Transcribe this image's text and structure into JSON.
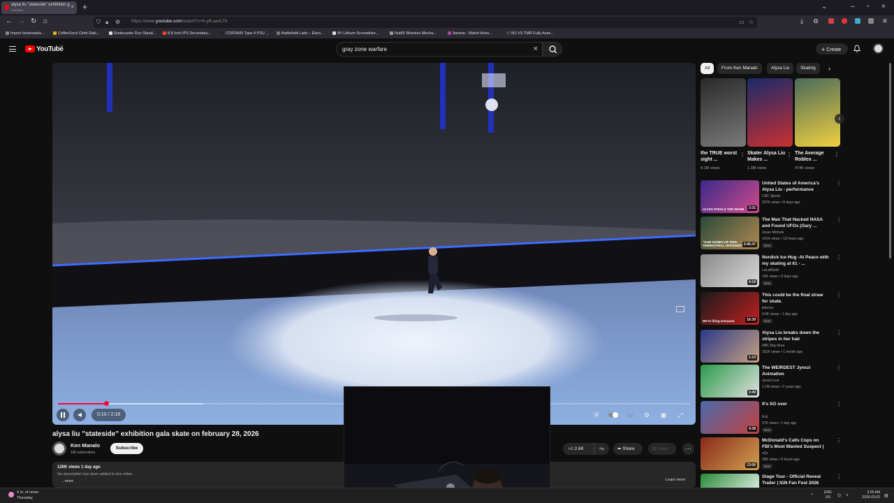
{
  "browser": {
    "tab_title": "alysa liu \"stateside\" exhibition g",
    "tab_sub": "PLAYING",
    "url_prefix": "https://www.",
    "url_domain": "youtube.com",
    "url_rest": "/watch?v=h-yB-awtLTk",
    "bookmarks": [
      {
        "label": "Import bookmarks...",
        "color": "#888888"
      },
      {
        "label": "CoffeeSock Cloth Disk...",
        "color": "#e8b400"
      },
      {
        "label": "Rodecaster Duo Stand...",
        "color": "#dddddd"
      },
      {
        "label": "8.8 Inch IPS Secondary...",
        "color": "#ff4422"
      },
      {
        "label": "CORSAIR Type 4 PSU ...",
        "color": "#222222"
      },
      {
        "label": "Battlefield Labs – Elect...",
        "color": "#777777"
      },
      {
        "label": "4V Lithium Screwdrive...",
        "color": "#dddddd"
      },
      {
        "label": "Nut65 Wireless Mecha...",
        "color": "#999999"
      },
      {
        "label": "9anime - Watch Anim...",
        "color": "#aa44aa"
      },
      {
        "label": "M1 VS TMR Fully Asse...",
        "color": "#444444"
      }
    ]
  },
  "youtube": {
    "logo_text": "YouTube",
    "region": "CA",
    "search_query": "gray zone warfare",
    "create_label": "Create"
  },
  "player": {
    "time": "0:10 / 2:18",
    "progress": 0.076
  },
  "video": {
    "title": "alysa liu \"stateside\" exhibition gala skate on february 28, 2026",
    "channel": "Ken Manalo",
    "subscribers": "160 subscribers",
    "subscribe_label": "Subscribe",
    "likes": "2.6K",
    "share_label": "Share",
    "save_label": "Save",
    "stats": "120K views  1 day ago",
    "description": "No description has been added to this video.",
    "more_label": "...more",
    "learn_more": "Learn more"
  },
  "chips": [
    "All",
    "From Ken Manalo",
    "Alysa Liu",
    "Skating"
  ],
  "shorts": [
    {
      "title": "the TRUE worst sight ...",
      "views": "4.1M views"
    },
    {
      "title": "Skater Alysa Liu Makes ...",
      "views": "1.3M views"
    },
    {
      "title": "The Average Roblox ...",
      "views": "474K views"
    }
  ],
  "recommendations": [
    {
      "title": "United States of America's Alysa Liu - performance Figure...",
      "channel": "CBC Sports",
      "meta": "297K views • 8 days ago",
      "duration": "3:31",
      "badge": "",
      "thumb_text": "ALYSA STEALS THE SHOW",
      "colors": [
        "#3a2a8a",
        "#d04a8a"
      ]
    },
    {
      "title": "The Man That Hacked NASA and Found UFOs (Gary ...",
      "channel": "Jesse Michels",
      "meta": "141K views • 13 hours ago",
      "duration": "2:06:47",
      "badge": "New",
      "thumb_text": "\"SAW NAMES OF NON-TERRESTRIAL OFFICERS\"",
      "colors": [
        "#2a4a3a",
        "#b08850"
      ]
    },
    {
      "title": "Nordick Ice Hug -At Peace with my skating at 61 - ...",
      "channel": "LaLaWorld",
      "meta": "15K views • 5 days ago",
      "duration": "4:19",
      "badge": "New",
      "thumb_text": "",
      "colors": [
        "#8a8a8a",
        "#d8d8d8"
      ]
    },
    {
      "title": "This could be the final straw for skate.",
      "channel": "kdence",
      "meta": "4.6K views • 1 day ago",
      "duration": "16:39",
      "badge": "New",
      "thumb_text": "We're firing everyone",
      "colors": [
        "#1a1a1a",
        "#c02020"
      ]
    },
    {
      "title": "Alysa Liu breaks down the stripes in her hair",
      "channel": "NBC Bay Area",
      "meta": "161K views • 1 month ago",
      "duration": "1:19",
      "badge": "",
      "thumb_text": "",
      "colors": [
        "#2a3a8a",
        "#c8a080"
      ]
    },
    {
      "title": "The WEIRDEST Jynxzi Animation",
      "channel": "Jynxzi Live",
      "meta": "1.1M views • 2 years ago",
      "duration": "3:49",
      "badge": "",
      "thumb_text": "",
      "colors": [
        "#2a9a4a",
        "#e0e0e0"
      ]
    },
    {
      "title": "It's SO over",
      "channel": "Eck",
      "meta": "57K views • 1 day ago",
      "duration": "4:38",
      "badge": "New",
      "thumb_text": "",
      "colors": [
        "#4a6aaa",
        "#c04040"
      ]
    },
    {
      "title": "McDonald's Calls Cops on FBI's Most Wanted Suspect | xQc ...",
      "channel": "xQc",
      "meta": "28K views • 6 hours ago",
      "duration": "13:06",
      "badge": "New",
      "thumb_text": "",
      "colors": [
        "#8a2a1a",
        "#d0a050"
      ]
    },
    {
      "title": "Stage Tour - Official Reveal Trailer | IGN Fan Fest 2026",
      "channel": "",
      "meta": "",
      "duration": "",
      "badge": "",
      "thumb_text": "STAGE",
      "colors": [
        "#2a8a3a",
        "#ffffff"
      ]
    }
  ],
  "taskbar": {
    "temp": "4 in. of snow",
    "day": "Thursday",
    "lang1": "ENG",
    "lang2": "US",
    "time": "3:05 AM",
    "date": "2026-03-02"
  }
}
